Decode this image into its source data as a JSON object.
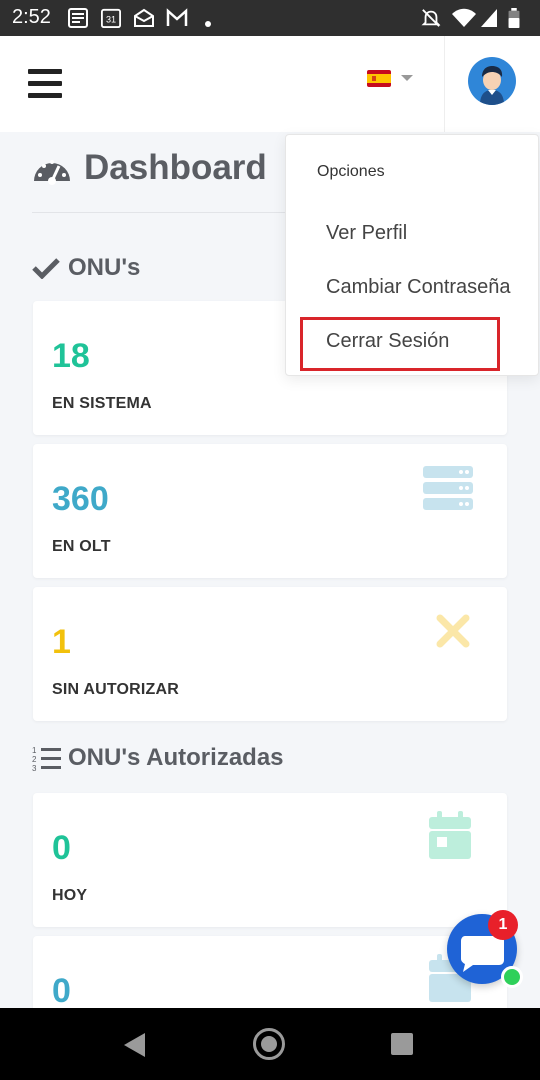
{
  "status_bar": {
    "time": "2:52",
    "icons": [
      "news-icon",
      "calendar-icon",
      "mail-open-icon",
      "gmail-icon",
      "dot-icon",
      "notifications-off-icon",
      "wifi-icon",
      "signal-icon",
      "battery-icon"
    ],
    "calendar_day": "31"
  },
  "header": {
    "language_flag": "spain-flag-icon",
    "avatar": "user-avatar"
  },
  "page_title": "Dashboard",
  "sections": {
    "onus_title": "ONU's",
    "authorized_title": "ONU's Autorizadas"
  },
  "cards": [
    {
      "value": "18",
      "label": "EN SISTEMA",
      "value_color": "#1fc398",
      "icon": "none"
    },
    {
      "value": "360",
      "label": "EN OLT",
      "value_color": "#3fa9c9",
      "icon": "server-icon"
    },
    {
      "value": "1",
      "label": "SIN AUTORIZAR",
      "value_color": "#f2c10c",
      "icon": "times-icon"
    },
    {
      "value": "0",
      "label": "HOY",
      "value_color": "#1fc398",
      "icon": "calendar-day-icon"
    },
    {
      "value": "0",
      "label": "",
      "value_color": "#3fa9c9",
      "icon": "calendar-icon"
    }
  ],
  "dropdown": {
    "header": "Opciones",
    "items": [
      "Ver Perfil",
      "Cambiar Contraseña",
      "Cerrar Sesión"
    ],
    "highlighted_item": "Cerrar Sesión"
  },
  "chat": {
    "badge_count": "1",
    "online": true
  },
  "colors": {
    "accent_green": "#1fc398",
    "accent_blue": "#3fa9c9",
    "accent_yellow": "#f2c10c",
    "highlight_red": "#d9252a",
    "chat_blue": "#1f63d6"
  }
}
